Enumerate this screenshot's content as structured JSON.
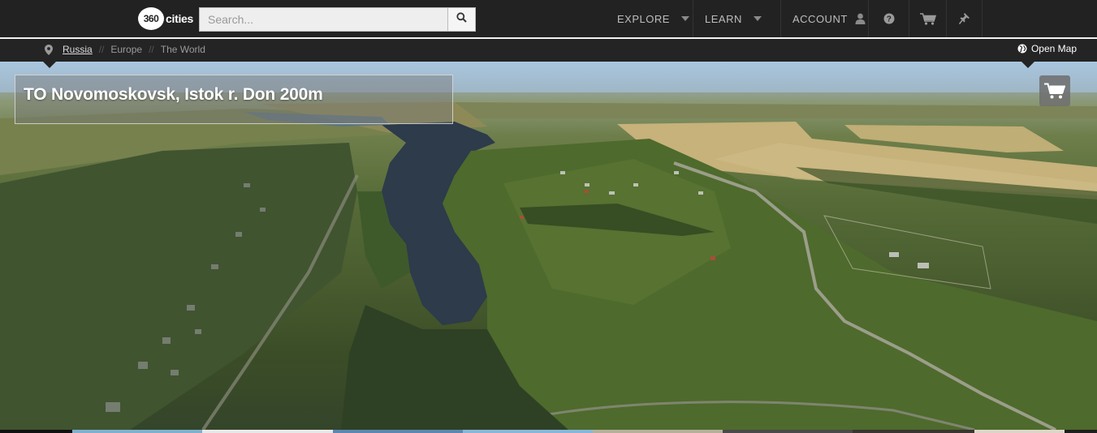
{
  "header": {
    "logo": {
      "badge_text": "360",
      "text": "cities"
    },
    "search": {
      "placeholder": "Search..."
    },
    "nav": {
      "explore_label": "EXPLORE",
      "learn_label": "LEARN",
      "account_label": "ACCOUNT"
    },
    "icons": {
      "search": "search-icon",
      "user": "user-icon",
      "help": "help-icon",
      "cart": "cart-icon",
      "pin": "pin-icon"
    }
  },
  "breadcrumb": {
    "items": [
      "Russia",
      "Europe",
      "The World"
    ],
    "separator": "//",
    "open_map_label": "Open Map"
  },
  "panorama": {
    "title": "TO Novomoskovsk, Istok r. Don 200m"
  },
  "colors": {
    "topbar": "#222222",
    "crumbbar": "#242424",
    "nav_text": "#bdbdbd",
    "title_text": "#ffffff"
  },
  "thumbnail_colors": [
    "#111111",
    "#7fb0cc",
    "#e8e8e8",
    "#5d87b0",
    "#88b6d8",
    "#b5b09a",
    "#4a4a4a",
    "#3a3530",
    "#ddd6c8"
  ]
}
